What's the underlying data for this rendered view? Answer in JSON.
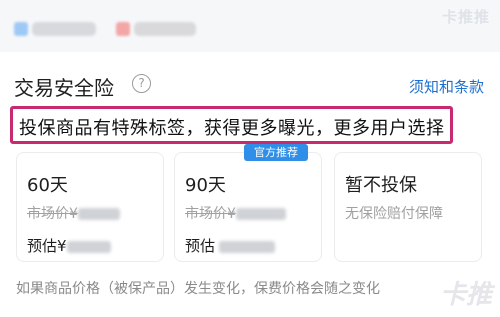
{
  "header": {
    "watermark": "卡推推"
  },
  "section": {
    "title": "交易安全险",
    "help_icon": "question-circle-icon",
    "terms_link": "须知和条款",
    "highlight_text": "投保商品有特殊标签，获得更多曝光，更多用户选择",
    "highlight_color": "#c72a6e",
    "link_color": "#1f6fd1"
  },
  "badge": {
    "label": "官方推荐",
    "color": "#2f8fe8"
  },
  "options": [
    {
      "title": "60天",
      "price_label": "市场价¥",
      "estimate_label": "预估¥"
    },
    {
      "title": "90天",
      "price_label": "市场价¥",
      "estimate_label": "预估"
    },
    {
      "title": "暂不投保",
      "subtitle": "无保险赔付保障"
    }
  ],
  "footer": {
    "note": "如果商品价格（被保产品）发生变化，保费价格会随之变化"
  }
}
